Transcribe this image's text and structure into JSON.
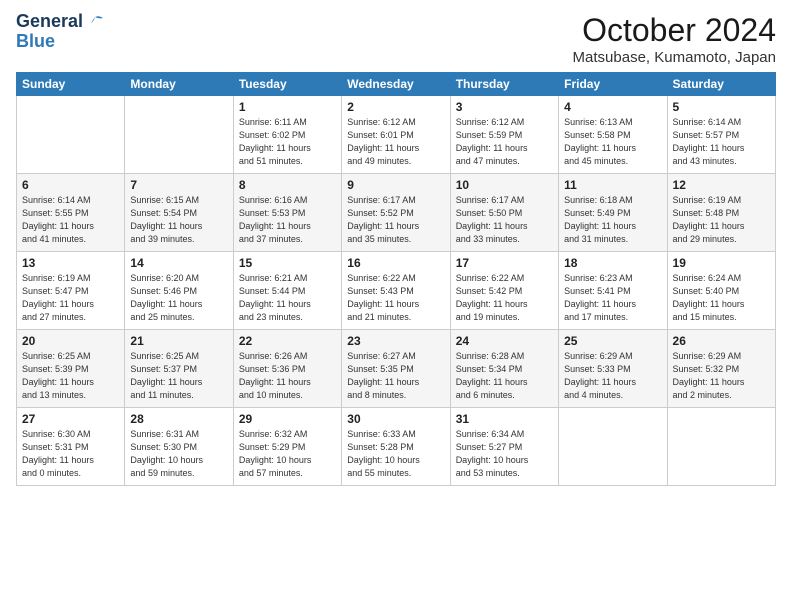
{
  "header": {
    "logo_line1": "General",
    "logo_line2": "Blue",
    "month_title": "October 2024",
    "location": "Matsubase, Kumamoto, Japan"
  },
  "weekdays": [
    "Sunday",
    "Monday",
    "Tuesday",
    "Wednesday",
    "Thursday",
    "Friday",
    "Saturday"
  ],
  "weeks": [
    [
      {
        "day": "",
        "info": ""
      },
      {
        "day": "",
        "info": ""
      },
      {
        "day": "1",
        "info": "Sunrise: 6:11 AM\nSunset: 6:02 PM\nDaylight: 11 hours\nand 51 minutes."
      },
      {
        "day": "2",
        "info": "Sunrise: 6:12 AM\nSunset: 6:01 PM\nDaylight: 11 hours\nand 49 minutes."
      },
      {
        "day": "3",
        "info": "Sunrise: 6:12 AM\nSunset: 5:59 PM\nDaylight: 11 hours\nand 47 minutes."
      },
      {
        "day": "4",
        "info": "Sunrise: 6:13 AM\nSunset: 5:58 PM\nDaylight: 11 hours\nand 45 minutes."
      },
      {
        "day": "5",
        "info": "Sunrise: 6:14 AM\nSunset: 5:57 PM\nDaylight: 11 hours\nand 43 minutes."
      }
    ],
    [
      {
        "day": "6",
        "info": "Sunrise: 6:14 AM\nSunset: 5:55 PM\nDaylight: 11 hours\nand 41 minutes."
      },
      {
        "day": "7",
        "info": "Sunrise: 6:15 AM\nSunset: 5:54 PM\nDaylight: 11 hours\nand 39 minutes."
      },
      {
        "day": "8",
        "info": "Sunrise: 6:16 AM\nSunset: 5:53 PM\nDaylight: 11 hours\nand 37 minutes."
      },
      {
        "day": "9",
        "info": "Sunrise: 6:17 AM\nSunset: 5:52 PM\nDaylight: 11 hours\nand 35 minutes."
      },
      {
        "day": "10",
        "info": "Sunrise: 6:17 AM\nSunset: 5:50 PM\nDaylight: 11 hours\nand 33 minutes."
      },
      {
        "day": "11",
        "info": "Sunrise: 6:18 AM\nSunset: 5:49 PM\nDaylight: 11 hours\nand 31 minutes."
      },
      {
        "day": "12",
        "info": "Sunrise: 6:19 AM\nSunset: 5:48 PM\nDaylight: 11 hours\nand 29 minutes."
      }
    ],
    [
      {
        "day": "13",
        "info": "Sunrise: 6:19 AM\nSunset: 5:47 PM\nDaylight: 11 hours\nand 27 minutes."
      },
      {
        "day": "14",
        "info": "Sunrise: 6:20 AM\nSunset: 5:46 PM\nDaylight: 11 hours\nand 25 minutes."
      },
      {
        "day": "15",
        "info": "Sunrise: 6:21 AM\nSunset: 5:44 PM\nDaylight: 11 hours\nand 23 minutes."
      },
      {
        "day": "16",
        "info": "Sunrise: 6:22 AM\nSunset: 5:43 PM\nDaylight: 11 hours\nand 21 minutes."
      },
      {
        "day": "17",
        "info": "Sunrise: 6:22 AM\nSunset: 5:42 PM\nDaylight: 11 hours\nand 19 minutes."
      },
      {
        "day": "18",
        "info": "Sunrise: 6:23 AM\nSunset: 5:41 PM\nDaylight: 11 hours\nand 17 minutes."
      },
      {
        "day": "19",
        "info": "Sunrise: 6:24 AM\nSunset: 5:40 PM\nDaylight: 11 hours\nand 15 minutes."
      }
    ],
    [
      {
        "day": "20",
        "info": "Sunrise: 6:25 AM\nSunset: 5:39 PM\nDaylight: 11 hours\nand 13 minutes."
      },
      {
        "day": "21",
        "info": "Sunrise: 6:25 AM\nSunset: 5:37 PM\nDaylight: 11 hours\nand 11 minutes."
      },
      {
        "day": "22",
        "info": "Sunrise: 6:26 AM\nSunset: 5:36 PM\nDaylight: 11 hours\nand 10 minutes."
      },
      {
        "day": "23",
        "info": "Sunrise: 6:27 AM\nSunset: 5:35 PM\nDaylight: 11 hours\nand 8 minutes."
      },
      {
        "day": "24",
        "info": "Sunrise: 6:28 AM\nSunset: 5:34 PM\nDaylight: 11 hours\nand 6 minutes."
      },
      {
        "day": "25",
        "info": "Sunrise: 6:29 AM\nSunset: 5:33 PM\nDaylight: 11 hours\nand 4 minutes."
      },
      {
        "day": "26",
        "info": "Sunrise: 6:29 AM\nSunset: 5:32 PM\nDaylight: 11 hours\nand 2 minutes."
      }
    ],
    [
      {
        "day": "27",
        "info": "Sunrise: 6:30 AM\nSunset: 5:31 PM\nDaylight: 11 hours\nand 0 minutes."
      },
      {
        "day": "28",
        "info": "Sunrise: 6:31 AM\nSunset: 5:30 PM\nDaylight: 10 hours\nand 59 minutes."
      },
      {
        "day": "29",
        "info": "Sunrise: 6:32 AM\nSunset: 5:29 PM\nDaylight: 10 hours\nand 57 minutes."
      },
      {
        "day": "30",
        "info": "Sunrise: 6:33 AM\nSunset: 5:28 PM\nDaylight: 10 hours\nand 55 minutes."
      },
      {
        "day": "31",
        "info": "Sunrise: 6:34 AM\nSunset: 5:27 PM\nDaylight: 10 hours\nand 53 minutes."
      },
      {
        "day": "",
        "info": ""
      },
      {
        "day": "",
        "info": ""
      }
    ]
  ]
}
